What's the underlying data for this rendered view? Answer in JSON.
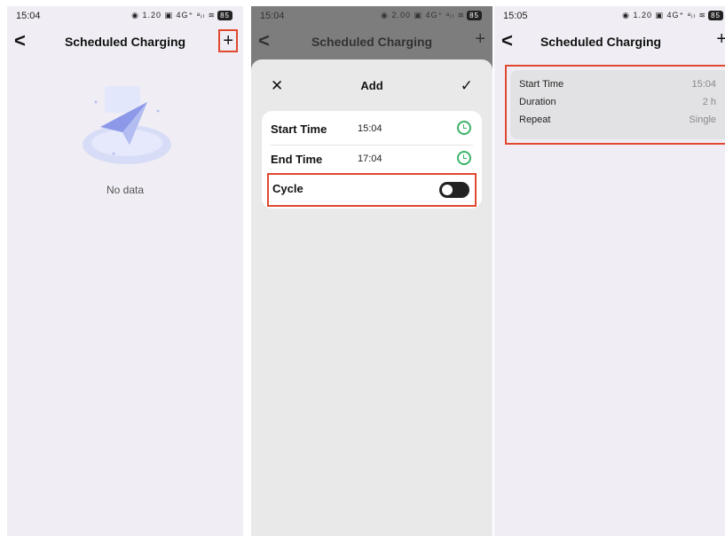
{
  "screens": [
    {
      "status_time": "15:04",
      "status_icons": "◉ 1.20 ▣ 4G⁺ ᵃᵢₗ ≋",
      "battery": "85",
      "nav_title": "Scheduled Charging",
      "back_glyph": "<",
      "add_glyph": "+",
      "empty_text": "No data"
    },
    {
      "status_time": "15:04",
      "status_icons": "◉ 2.00 ▣ 4G⁺ ᵃᵢₗ ≋",
      "battery": "85",
      "nav_title": "Scheduled Charging",
      "back_glyph": "<",
      "add_glyph": "+",
      "sheet": {
        "close_glyph": "✕",
        "title": "Add",
        "confirm_glyph": "✓",
        "start_label": "Start Time",
        "start_value": "15:04",
        "end_label": "End Time",
        "end_value": "17:04",
        "cycle_label": "Cycle",
        "cycle_on": false
      }
    },
    {
      "status_time": "15:05",
      "status_icons": "◉ 1.20 ▣ 4G⁺ ᵃᵢₗ ≋",
      "battery": "85",
      "nav_title": "Scheduled Charging",
      "back_glyph": "<",
      "add_glyph": "+",
      "summary": {
        "start_key": "Start Time",
        "start_val": "15:04",
        "duration_key": "Duration",
        "duration_val": "2 h",
        "repeat_key": "Repeat",
        "repeat_val": "Single"
      }
    }
  ],
  "colors": {
    "highlight": "#e0482f",
    "clock_green": "#3cb36a",
    "screen_bg": "#f0eef4"
  }
}
